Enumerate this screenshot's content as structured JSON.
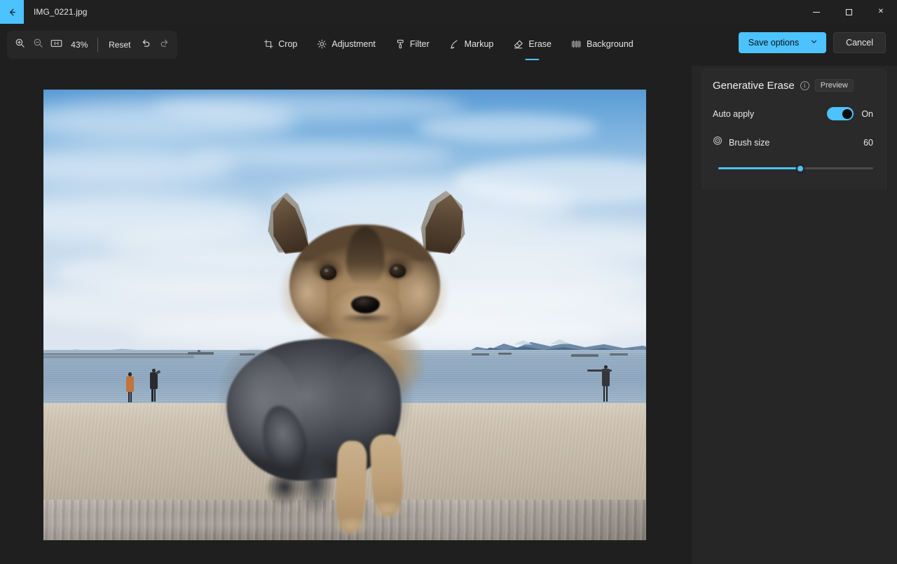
{
  "titlebar": {
    "back_icon": "back-arrow-icon",
    "file_name": "IMG_0221.jpg",
    "minimize_label": "Minimize",
    "maximize_label": "Maximize",
    "close_label": "Close"
  },
  "zoom_toolbar": {
    "zoom_in_icon": "zoom-in-icon",
    "zoom_out_icon": "zoom-out-icon",
    "fit_icon": "fit-to-window-icon",
    "zoom_level": "43%",
    "reset_label": "Reset",
    "undo_icon": "undo-icon",
    "redo_icon": "redo-icon"
  },
  "tools": [
    {
      "label": "Crop",
      "icon": "crop-icon",
      "selected": false
    },
    {
      "label": "Adjustment",
      "icon": "brightness-icon",
      "selected": false
    },
    {
      "label": "Filter",
      "icon": "filter-icon",
      "selected": false
    },
    {
      "label": "Markup",
      "icon": "pen-icon",
      "selected": false
    },
    {
      "label": "Erase",
      "icon": "eraser-icon",
      "selected": true
    },
    {
      "label": "Background",
      "icon": "background-icon",
      "selected": false
    }
  ],
  "actions": {
    "save_options_label": "Save options",
    "save_options_chevron": "chevron-down-icon",
    "cancel_label": "Cancel"
  },
  "panel": {
    "title": "Generative Erase",
    "info_icon": "info-icon",
    "info_glyph": "i",
    "preview_badge": "Preview",
    "auto_apply": {
      "label": "Auto apply",
      "state": "On",
      "checked": true
    },
    "brush_size": {
      "icon": "brush-size-icon",
      "label": "Brush size",
      "value": "60",
      "percent": 53
    }
  },
  "canvas": {
    "image_alt": "Yorkshire terrier standing on a weathered driftwood log at a sandy beach with ocean, distant mountains, ships and two people in the background",
    "cursor_icon": "mouse-pointer-icon"
  },
  "colors": {
    "accent": "#4cc2ff",
    "window_bg": "#1f1f1f",
    "titlebar_bg": "#202020",
    "panel_bg": "#2a2a2a",
    "sidepane_bg": "#262626",
    "text_primary": "#e6e6e6"
  }
}
